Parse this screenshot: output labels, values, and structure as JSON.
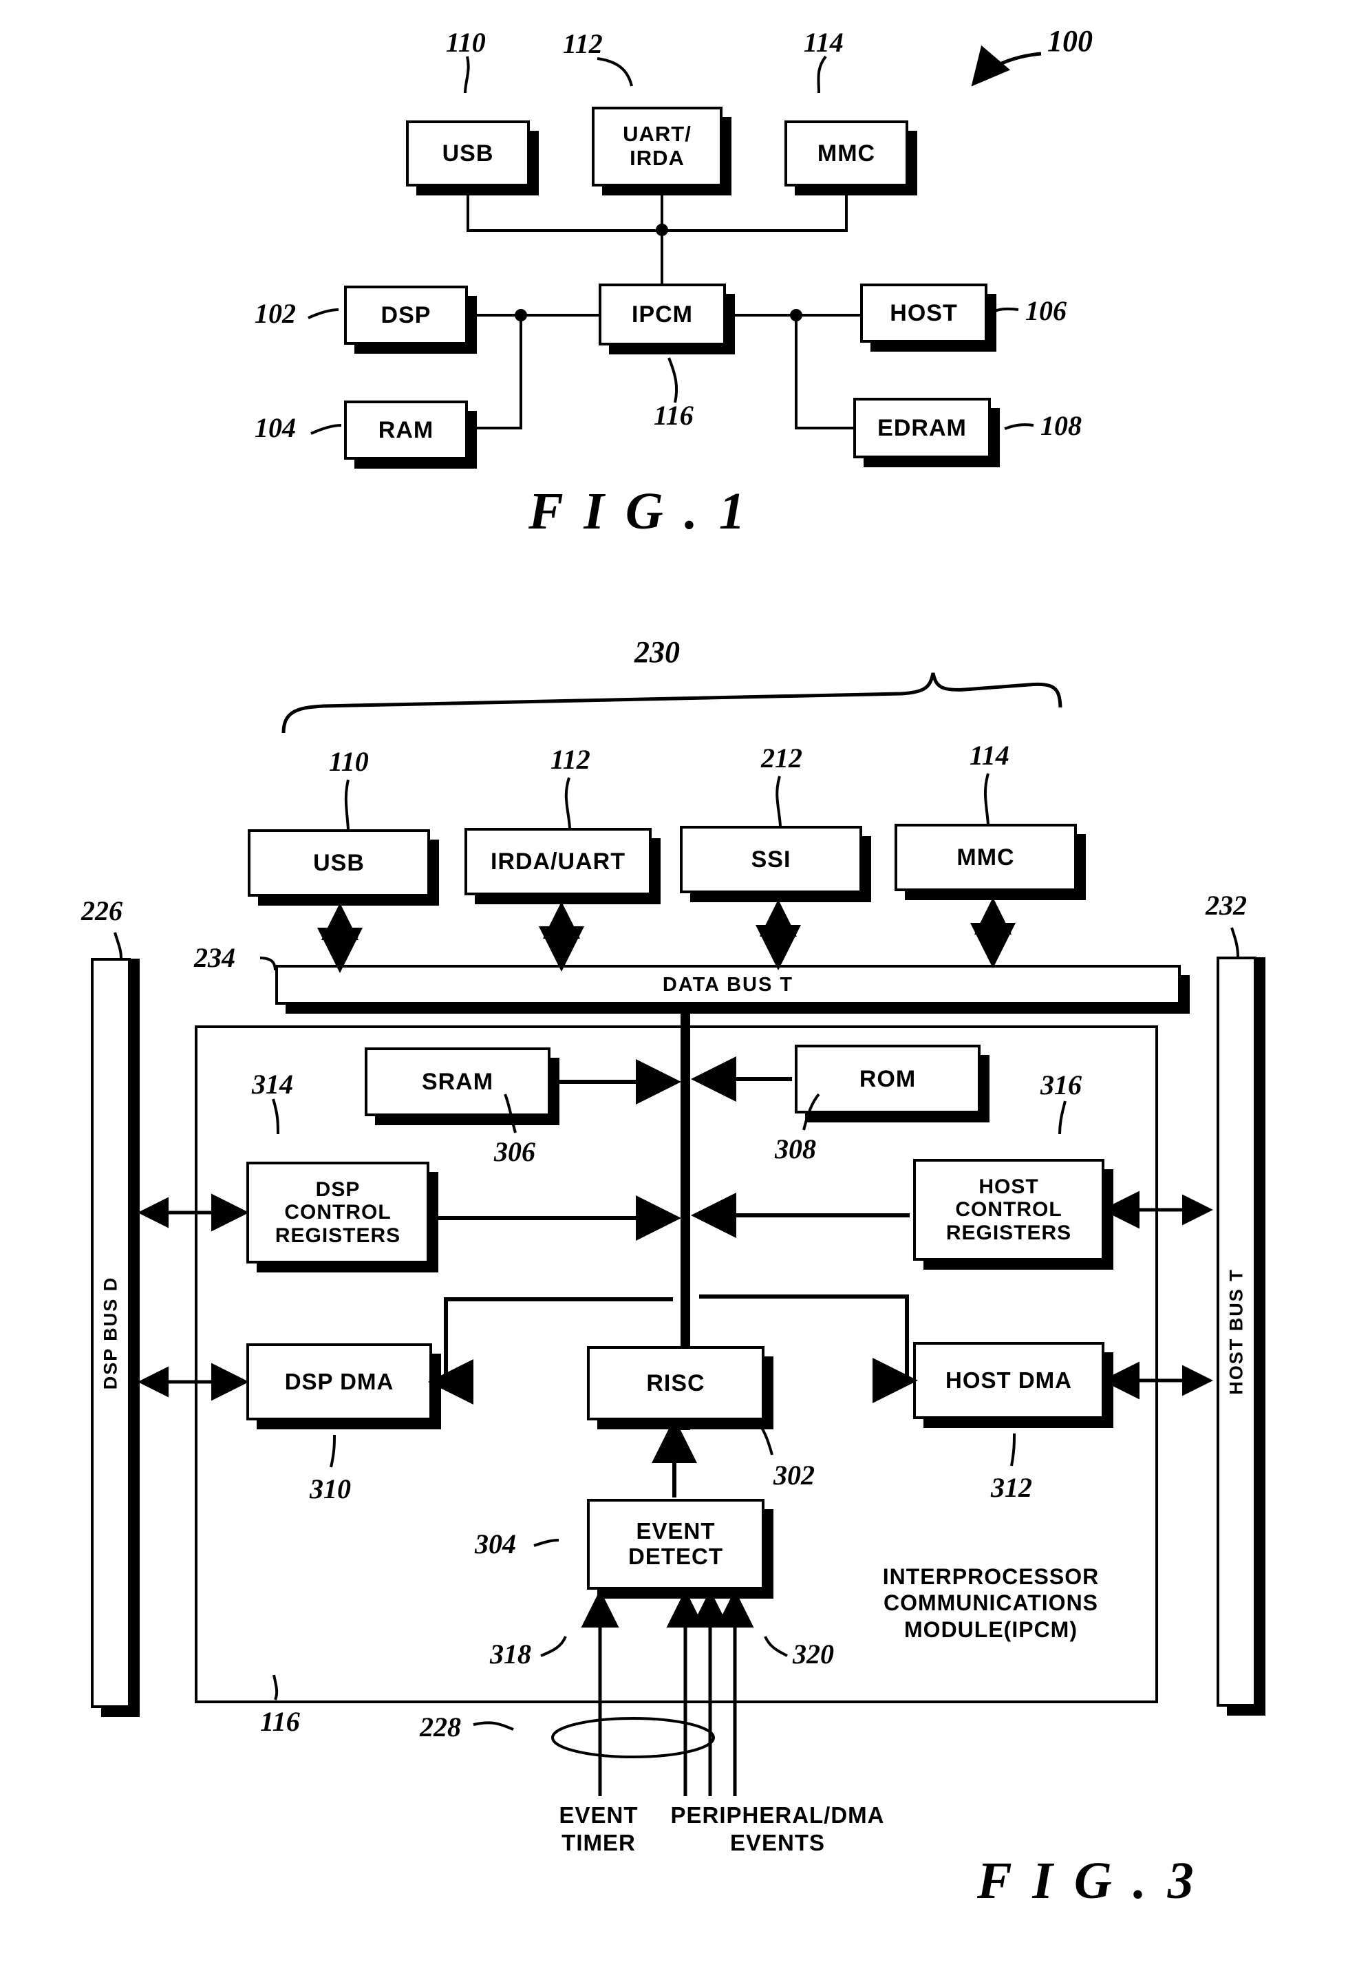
{
  "figures": [
    {
      "id": "fig1",
      "title": "F I G . 1",
      "system_ref": "100",
      "blocks": [
        {
          "key": "usb",
          "label": "USB",
          "ref": "110"
        },
        {
          "key": "uart",
          "label": "UART/\nIRDA",
          "ref": "112"
        },
        {
          "key": "mmc",
          "label": "MMC",
          "ref": "114"
        },
        {
          "key": "dsp",
          "label": "DSP",
          "ref": "102"
        },
        {
          "key": "ipcm",
          "label": "IPCM",
          "ref": "116"
        },
        {
          "key": "host",
          "label": "HOST",
          "ref": "106"
        },
        {
          "key": "ram",
          "label": "RAM",
          "ref": "104"
        },
        {
          "key": "edram",
          "label": "EDRAM",
          "ref": "108"
        }
      ]
    },
    {
      "id": "fig3",
      "title": "F I G . 3",
      "peripheral_group_ref": "230",
      "module_ref": "116",
      "module_caption": "INTERPROCESSOR\nCOMMUNICATIONS\nMODULE(IPCM)",
      "buses": [
        {
          "key": "dsp_bus",
          "label": "DSP BUS D",
          "ref": "226"
        },
        {
          "key": "data_bus",
          "label": "DATA BUS T",
          "ref": "234"
        },
        {
          "key": "host_bus",
          "label": "HOST BUS T",
          "ref": "232"
        }
      ],
      "peripherals": [
        {
          "key": "usb",
          "label": "USB",
          "ref": "110"
        },
        {
          "key": "irda",
          "label": "IRDA/UART",
          "ref": "112"
        },
        {
          "key": "ssi",
          "label": "SSI",
          "ref": "212"
        },
        {
          "key": "mmc",
          "label": "MMC",
          "ref": "114"
        }
      ],
      "blocks": [
        {
          "key": "sram",
          "label": "SRAM",
          "ref": "306"
        },
        {
          "key": "rom",
          "label": "ROM",
          "ref": "308"
        },
        {
          "key": "dsp_ctrl",
          "label": "DSP\nCONTROL\nREGISTERS",
          "ref": "314"
        },
        {
          "key": "host_ctrl",
          "label": "HOST\nCONTROL\nREGISTERS",
          "ref": "316"
        },
        {
          "key": "dsp_dma",
          "label": "DSP DMA",
          "ref": "310"
        },
        {
          "key": "host_dma",
          "label": "HOST DMA",
          "ref": "312"
        },
        {
          "key": "risc",
          "label": "RISC",
          "ref": "302"
        },
        {
          "key": "event",
          "label": "EVENT\nDETECT",
          "ref": "304"
        }
      ],
      "event_inputs": [
        {
          "key": "timer",
          "label": "EVENT\nTIMER",
          "ref": "318"
        },
        {
          "key": "events",
          "label": "PERIPHERAL/DMA\nEVENTS",
          "ref": "320"
        }
      ],
      "event_bundle_ref": "228"
    }
  ]
}
